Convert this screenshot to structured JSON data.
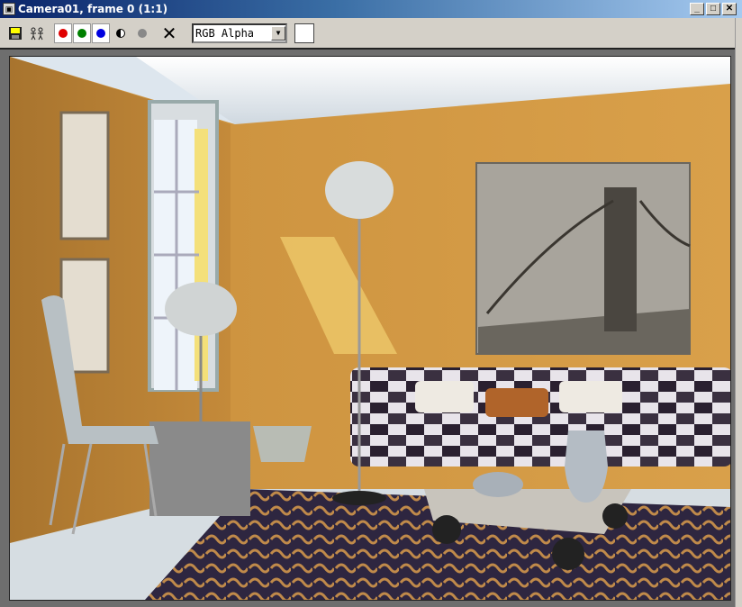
{
  "window": {
    "title": "Camera01, frame 0 (1:1)",
    "icon": "max-app-icon",
    "controls": [
      "minimize",
      "maximize",
      "close"
    ]
  },
  "toolbar": {
    "icons": [
      "save-icon",
      "clone-icon",
      "red-channel-icon",
      "green-channel-icon",
      "blue-channel-icon",
      "mono-icon",
      "alpha-dot-icon",
      "clear-icon"
    ],
    "channel_colors": {
      "red": "#e00000",
      "green": "#008000",
      "blue": "#0000e0"
    },
    "channel_select": "RGB Alpha",
    "swatch_color": "#ffffff"
  },
  "labels": {
    "min": "_",
    "max": "□",
    "close": "✕",
    "dd": "▼",
    "x": "✕"
  }
}
